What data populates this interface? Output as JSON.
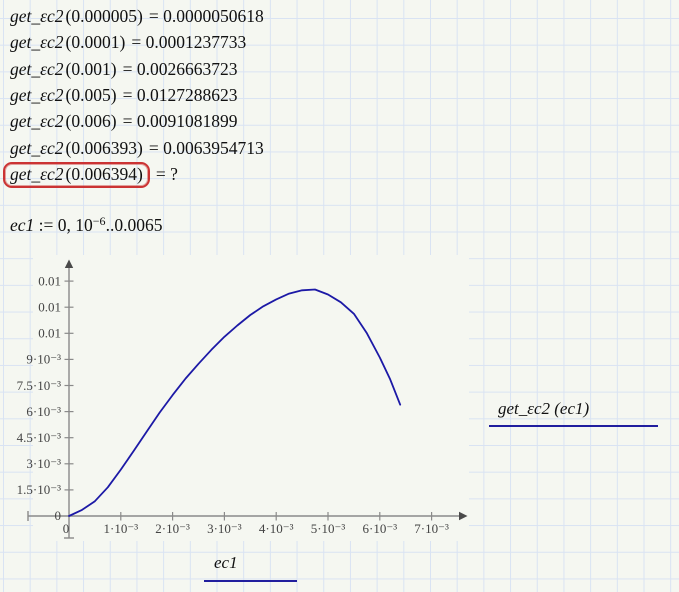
{
  "math_lines": [
    {
      "func": "get_εc2",
      "arg": "(0.000005)",
      "rhs": "= 0.0000050618"
    },
    {
      "func": "get_εc2",
      "arg": "(0.0001)",
      "rhs": "= 0.0001237733"
    },
    {
      "func": "get_εc2",
      "arg": "(0.001)",
      "rhs": "= 0.0026663723"
    },
    {
      "func": "get_εc2",
      "arg": "(0.005)",
      "rhs": "= 0.0127288623"
    },
    {
      "func": "get_εc2",
      "arg": "(0.006)",
      "rhs": "= 0.0091081899"
    },
    {
      "func": "get_εc2",
      "arg": "(0.006393)",
      "rhs": "= 0.0063954713"
    },
    {
      "func": "get_εc2",
      "arg": "(0.006394)",
      "rhs": "= ?"
    }
  ],
  "definition": {
    "var": "ec1",
    "mid": " := 0, 10",
    "sup": "−6",
    "post": "..0.0065"
  },
  "labels": {
    "y_trace": "get_εc2 (ec1)",
    "x_var": "ec1"
  },
  "plot": {
    "axis_color": "#8a8a8a",
    "arrow_color": "#4a4a4a",
    "tick_label_color": "#444444",
    "curve_color": "#1c19a6",
    "x_tick_labels": [
      "1·10⁻³",
      "2·10⁻³",
      "3·10⁻³",
      "4·10⁻³",
      "5·10⁻³",
      "6·10⁻³",
      "7·10⁻³"
    ],
    "y_tick_labels": [
      "1.5·10⁻³",
      "3·10⁻³",
      "4.5·10⁻³",
      "6·10⁻³",
      "7.5·10⁻³",
      "9·10⁻³",
      "0.01",
      "0.01",
      "0.01"
    ],
    "origin_label": "0"
  },
  "chart_data": {
    "type": "line",
    "title": "",
    "xlabel": "ec1",
    "ylabel": "get_εc2(ec1)",
    "legend": "get_εc2 (ec1)",
    "legend_position": "right",
    "grid": false,
    "xlim": [
      0,
      0.0077
    ],
    "ylim": [
      0,
      0.0135
    ],
    "x_ticks": [
      0.001,
      0.002,
      0.003,
      0.004,
      0.005,
      0.006,
      0.007
    ],
    "y_ticks": [
      0.0015,
      0.003,
      0.0045,
      0.006,
      0.0075,
      0.009,
      0.0105,
      0.012,
      0.0135
    ],
    "series": [
      {
        "name": "get_εc2(ec1)",
        "points": [
          [
            0,
            0
          ],
          [
            0.00025,
            0.00035
          ],
          [
            0.0005,
            0.00085
          ],
          [
            0.00075,
            0.00165
          ],
          [
            0.001,
            0.0026663723
          ],
          [
            0.00125,
            0.00375
          ],
          [
            0.0015,
            0.00485
          ],
          [
            0.00175,
            0.00595
          ],
          [
            0.002,
            0.00695
          ],
          [
            0.00225,
            0.0079
          ],
          [
            0.0025,
            0.00875
          ],
          [
            0.00275,
            0.00955
          ],
          [
            0.003,
            0.0103
          ],
          [
            0.00325,
            0.01095
          ],
          [
            0.0035,
            0.01155
          ],
          [
            0.00375,
            0.01205
          ],
          [
            0.004,
            0.01245
          ],
          [
            0.00425,
            0.01278
          ],
          [
            0.0045,
            0.01297
          ],
          [
            0.00475,
            0.01302
          ],
          [
            0.005,
            0.0127288623
          ],
          [
            0.00525,
            0.01228
          ],
          [
            0.0055,
            0.01162
          ],
          [
            0.00575,
            0.0105
          ],
          [
            0.006,
            0.0091081899
          ],
          [
            0.0062,
            0.00785
          ],
          [
            0.006393,
            0.0063954713
          ]
        ]
      }
    ]
  }
}
